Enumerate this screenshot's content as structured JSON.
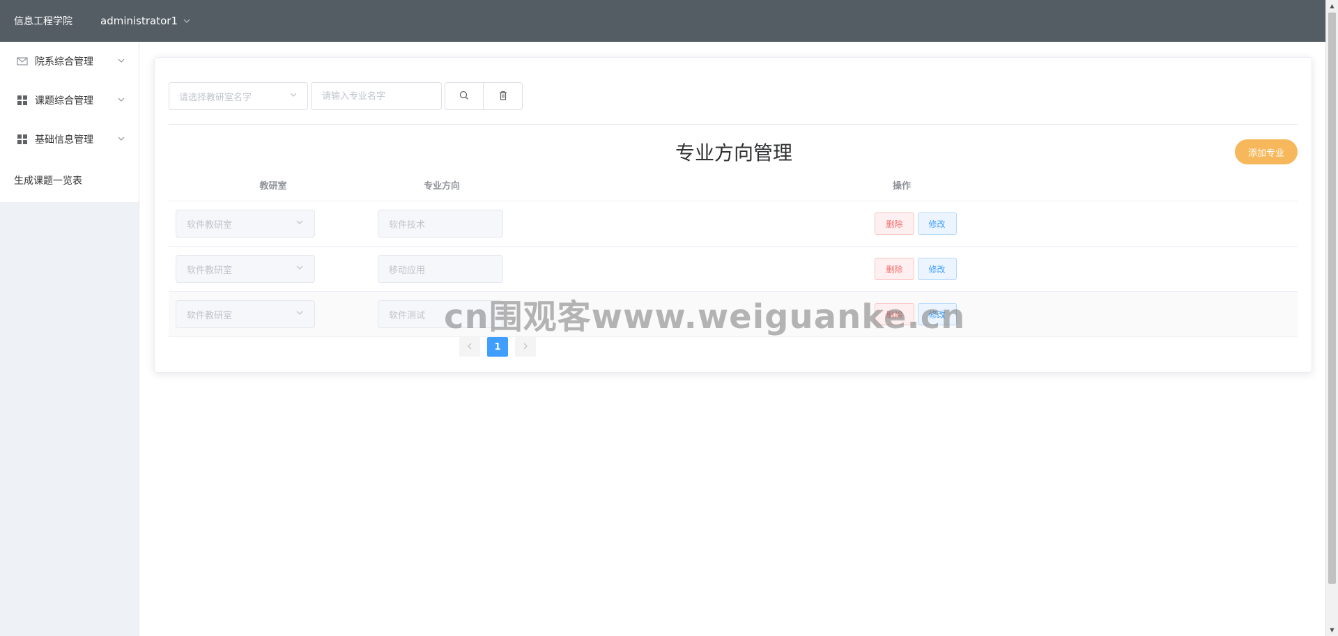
{
  "header": {
    "brand": "信息工程学院",
    "username": "administrator1",
    "background_color": "#545c64"
  },
  "sidebar": {
    "items": [
      {
        "label": "院系综合管理",
        "icon": "envelope-icon"
      },
      {
        "label": "课题综合管理",
        "icon": "grid-icon"
      },
      {
        "label": "基础信息管理",
        "icon": "grid-icon"
      },
      {
        "label": "生成课题一览表"
      }
    ]
  },
  "toolbar": {
    "department_placeholder": "请选择教研室名字",
    "major_placeholder": "请输入专业名字",
    "search_icon": "search-icon",
    "clear_icon": "trash-icon"
  },
  "page": {
    "title": "专业方向管理",
    "add_button": "添加专业",
    "add_button_color": "#f7b85b"
  },
  "table": {
    "headers": [
      "教研室",
      "专业方向",
      "操作"
    ],
    "rows": [
      {
        "department": "软件教研室",
        "major": "软件技术",
        "delete": "删除",
        "edit": "修改"
      },
      {
        "department": "软件教研室",
        "major": "移动应用",
        "delete": "删除",
        "edit": "修改"
      },
      {
        "department": "软件教研室",
        "major": "软件测试",
        "delete": "删除",
        "edit": "修改"
      }
    ]
  },
  "pagination": {
    "current": "1",
    "prev_icon": "chevron-left-icon",
    "next_icon": "chevron-right-icon",
    "active_color": "#409eff"
  },
  "watermark": {
    "text": "cn围观客www.weiguanke.cn"
  }
}
